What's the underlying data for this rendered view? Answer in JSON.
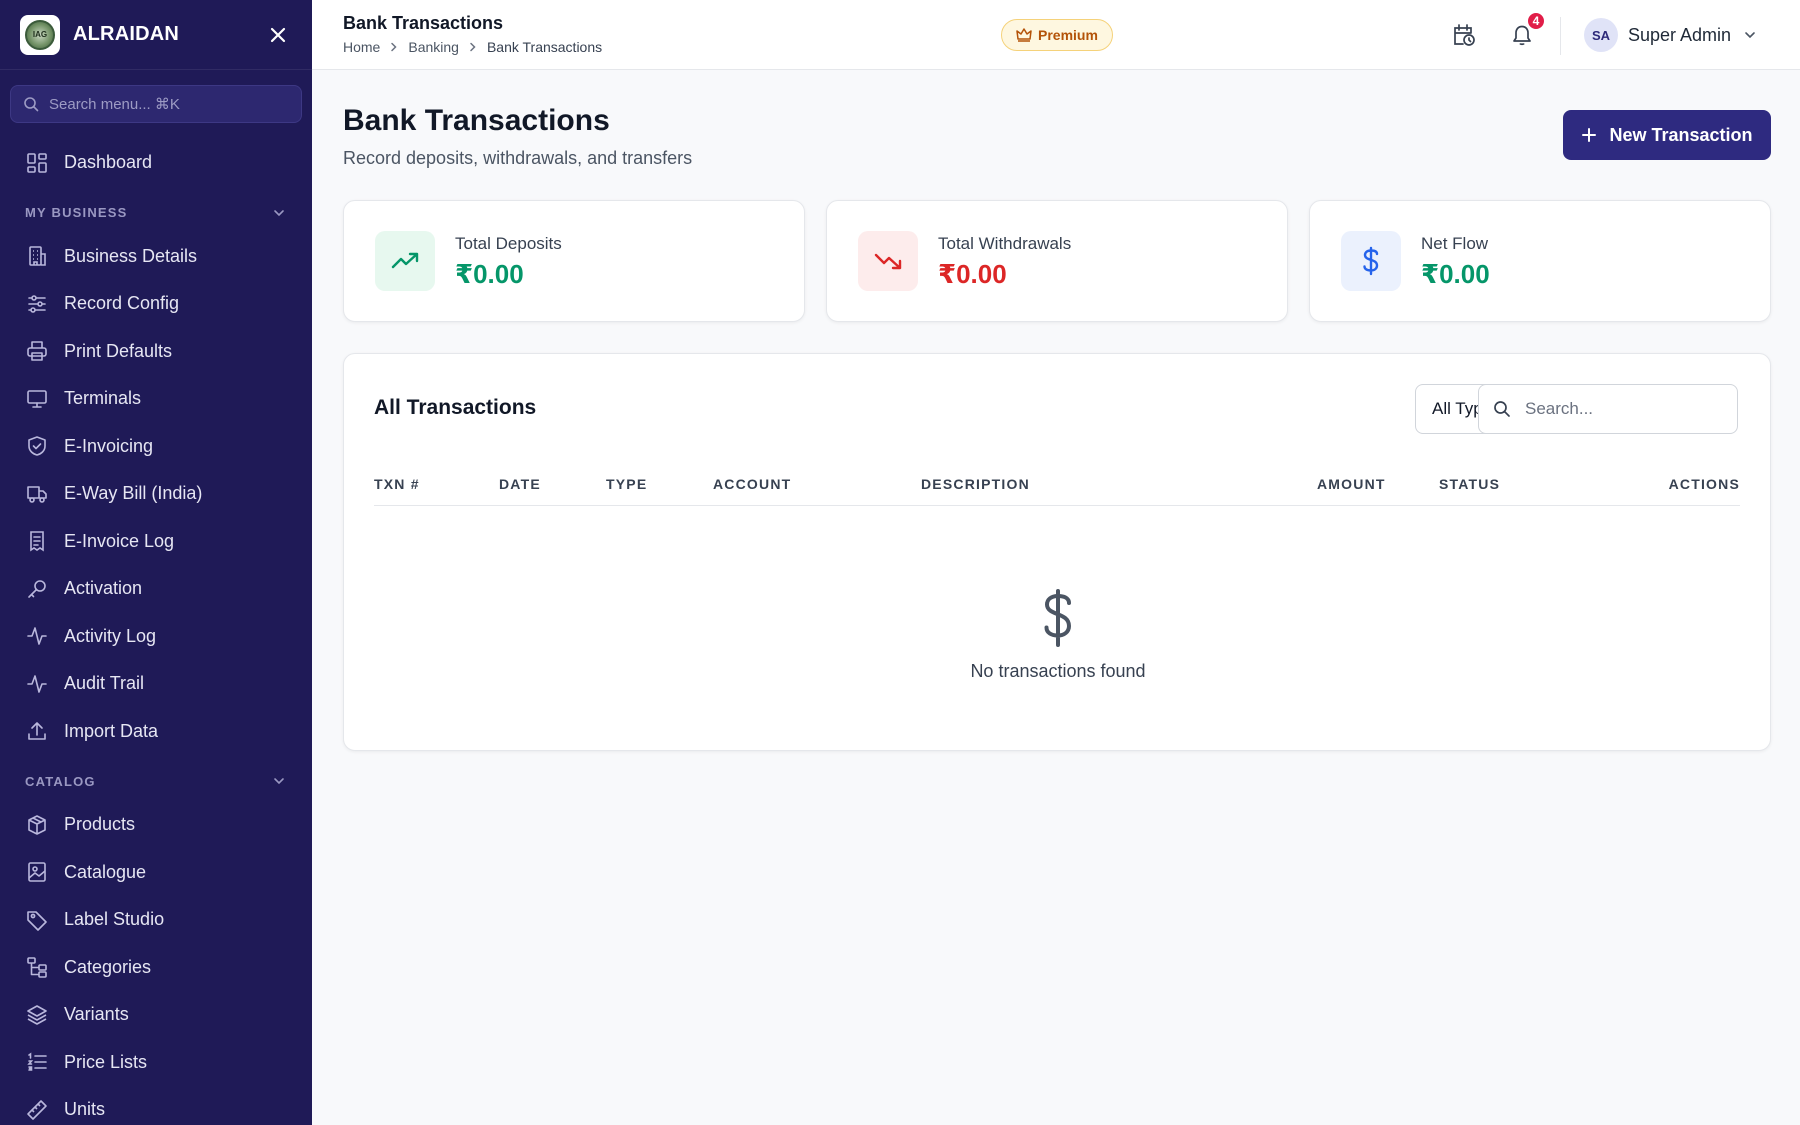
{
  "sidebar": {
    "brand": "ALRAIDAN",
    "logo_text": "IAG",
    "search_placeholder": "Search menu... ⌘K",
    "dashboard": {
      "label": "Dashboard",
      "icon": "dashboard-icon"
    },
    "sections": [
      {
        "title": "MY BUSINESS",
        "items": [
          {
            "label": "Business Details",
            "icon": "building-icon"
          },
          {
            "label": "Record Config",
            "icon": "sliders-icon"
          },
          {
            "label": "Print Defaults",
            "icon": "printer-icon"
          },
          {
            "label": "Terminals",
            "icon": "monitor-icon"
          },
          {
            "label": "E-Invoicing",
            "icon": "shield-check-icon"
          },
          {
            "label": "E-Way Bill (India)",
            "icon": "truck-icon"
          },
          {
            "label": "E-Invoice Log",
            "icon": "receipt-icon"
          },
          {
            "label": "Activation",
            "icon": "key-icon"
          },
          {
            "label": "Activity Log",
            "icon": "activity-icon"
          },
          {
            "label": "Audit Trail",
            "icon": "activity-icon"
          },
          {
            "label": "Import Data",
            "icon": "upload-icon"
          }
        ]
      },
      {
        "title": "CATALOG",
        "items": [
          {
            "label": "Products",
            "icon": "box-icon"
          },
          {
            "label": "Catalogue",
            "icon": "image-icon"
          },
          {
            "label": "Label Studio",
            "icon": "tag-icon"
          },
          {
            "label": "Categories",
            "icon": "tree-icon"
          },
          {
            "label": "Variants",
            "icon": "layers-icon"
          },
          {
            "label": "Price Lists",
            "icon": "list-icon"
          },
          {
            "label": "Units",
            "icon": "ruler-icon"
          }
        ]
      }
    ]
  },
  "topbar": {
    "title": "Bank Transactions",
    "breadcrumb": [
      "Home",
      "Banking",
      "Bank Transactions"
    ],
    "premium_label": "Premium",
    "notifications_count": "4",
    "user_initials": "SA",
    "user_name": "Super Admin"
  },
  "page": {
    "title": "Bank Transactions",
    "subtitle": "Record deposits, withdrawals, and transfers",
    "new_button": "New Transaction"
  },
  "stats": [
    {
      "label": "Total Deposits",
      "value": "₹0.00",
      "color": "#059669"
    },
    {
      "label": "Total Withdrawals",
      "value": "₹0.00",
      "color": "#dc2626"
    },
    {
      "label": "Net Flow",
      "value": "₹0.00",
      "color": "#059669"
    }
  ],
  "transactions": {
    "title": "All Transactions",
    "filter_value": "All Types",
    "search_placeholder": "Search...",
    "columns": [
      "TXN #",
      "DATE",
      "TYPE",
      "ACCOUNT",
      "DESCRIPTION",
      "AMOUNT",
      "STATUS",
      "ACTIONS"
    ],
    "rows": [],
    "empty_text": "No transactions found"
  },
  "colors": {
    "sidebar_bg": "#1f1a57",
    "accent": "#2e2a80",
    "positive": "#059669",
    "negative": "#dc2626",
    "premium": "#b45309"
  }
}
